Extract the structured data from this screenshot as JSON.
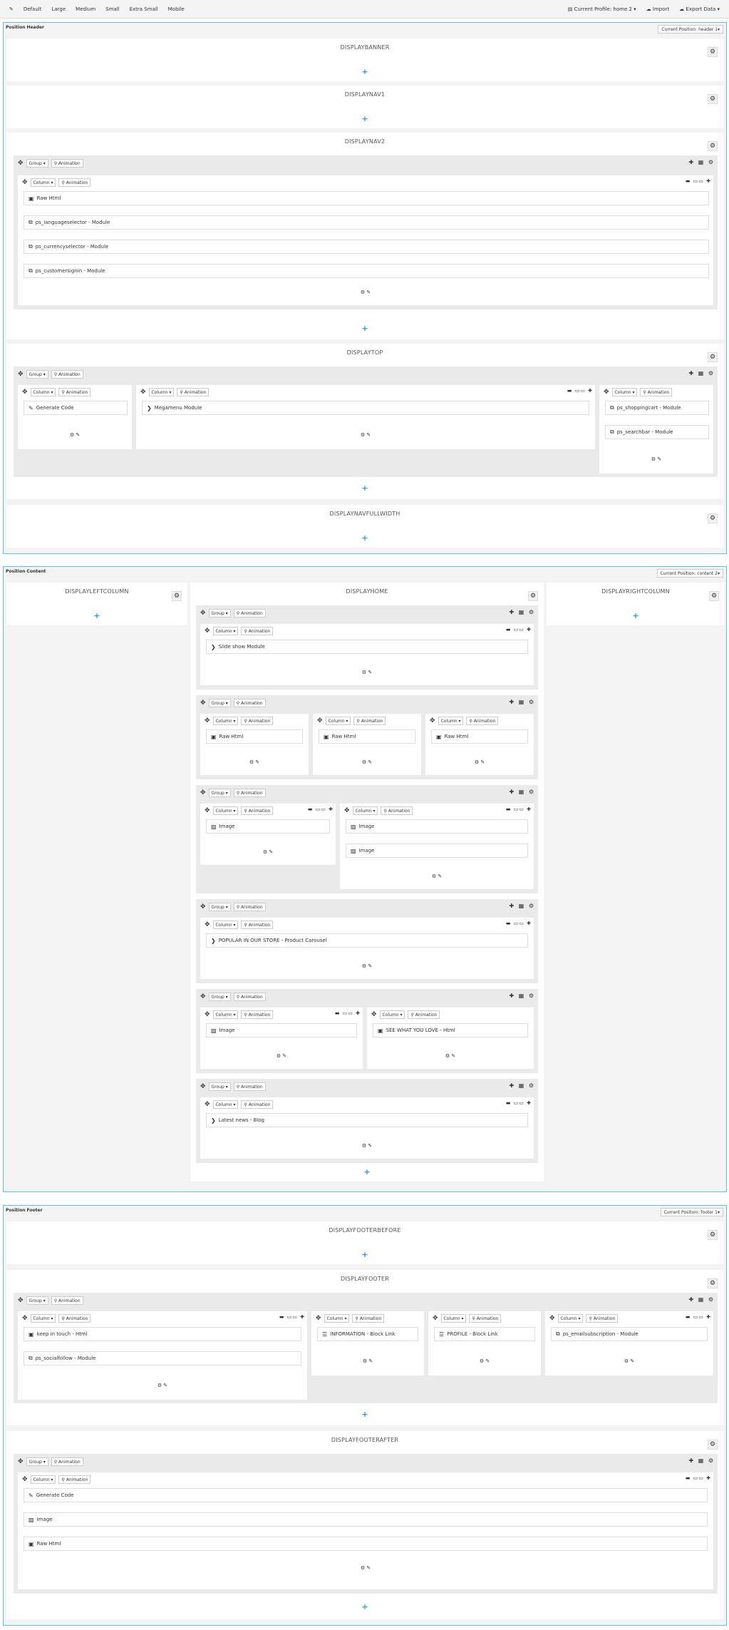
{
  "toolbar": {
    "items": [
      "Default",
      "Large",
      "Medium",
      "Small",
      "Extra Small",
      "Mobile"
    ],
    "profile": "Current Profile: home 2",
    "import": "Import",
    "export": "Export Data"
  },
  "common": {
    "group": "Group",
    "column": "Column",
    "animation": "Animation",
    "caret": "▾",
    "plus": "+",
    "gear": "⚙",
    "move": "✥",
    "edit": "✎",
    "group_icons": "✚ ▦ ⚙",
    "col_icons": "▬ ▭▭ ✚",
    "col_foot": "⚙ ✎"
  },
  "header": {
    "title": "Position Header",
    "current": "Current Position: header 1",
    "hooks": {
      "banner": "DISPLAYBANNER",
      "nav1": "DISPLAYNAV1",
      "nav2": "DISPLAYNAV2",
      "top": "DISPLAYTOP",
      "navfull": "DISPLAYNAVFULLWIDTH"
    },
    "nav2_modules": [
      "Raw Html",
      "ps_languageselector - Module",
      "ps_currencyselector - Module",
      "ps_customersignin - Module"
    ],
    "top_modules": {
      "c1": "Generate Code",
      "c2": "Megamenu Module",
      "c3a": "ps_shoppingcart - Module",
      "c3b": "ps_searchbar - Module"
    }
  },
  "content": {
    "title": "Position Content",
    "current": "Current Position: content 2",
    "hooks": {
      "left": "DISPLAYLEFTCOLUMN",
      "home": "DISPLAYHOME",
      "right": "DISPLAYRIGHTCOLUMN"
    },
    "modules": {
      "slideshow": "Slide show Module",
      "raw": "Raw Html",
      "image": "Image",
      "popular": "POPULAR IN OUR STORE - Product Carousel",
      "seewhat": "SEE WHAT YOU LOVE - Html",
      "news": "Latest news - Blog"
    }
  },
  "footer": {
    "title": "Position Footer",
    "current": "Current Position: footer 1",
    "hooks": {
      "before": "DISPLAYFOOTERBEFORE",
      "footer": "DISPLAYFOOTER",
      "after": "DISPLAYFOOTERAFTER"
    },
    "modules": {
      "keep": "keep in touch - Html",
      "social": "ps_socialfollow - Module",
      "info": "INFORMATION - Block Link",
      "profile": "PROFILE - Block Link",
      "email": "ps_emailsubscription - Module",
      "gen": "Generate Code",
      "image": "Image",
      "raw": "Raw Html"
    }
  },
  "icons": {
    "html": "html5-icon",
    "module": "module-icon",
    "code": "code-icon",
    "chevron": "chevron-right-icon",
    "image": "image-icon",
    "list": "list-icon"
  }
}
